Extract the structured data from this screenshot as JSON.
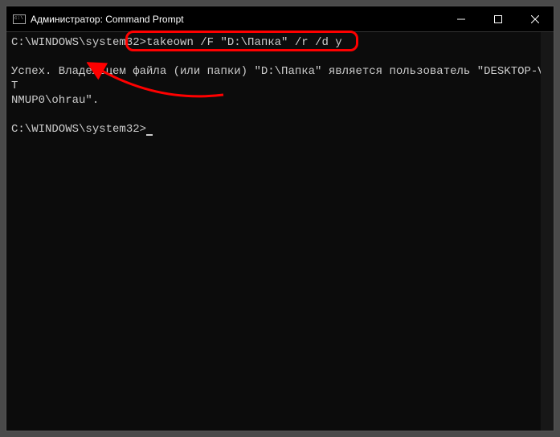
{
  "window": {
    "title": "Администратор: Command Prompt"
  },
  "terminal": {
    "prompt1": "C:\\WINDOWS\\system32>",
    "command1": "takeown /F \"D:\\Папка\" /r /d y",
    "blank1": "",
    "output_line1": "Успех. Владельцем файла (или папки) \"D:\\Папка\" является пользователь \"DESKTOP-VT",
    "output_line2": "NMUP0\\ohrau\".",
    "blank2": "",
    "prompt2": "C:\\WINDOWS\\system32>"
  },
  "annotation": {
    "highlight_color": "#ff0000"
  }
}
